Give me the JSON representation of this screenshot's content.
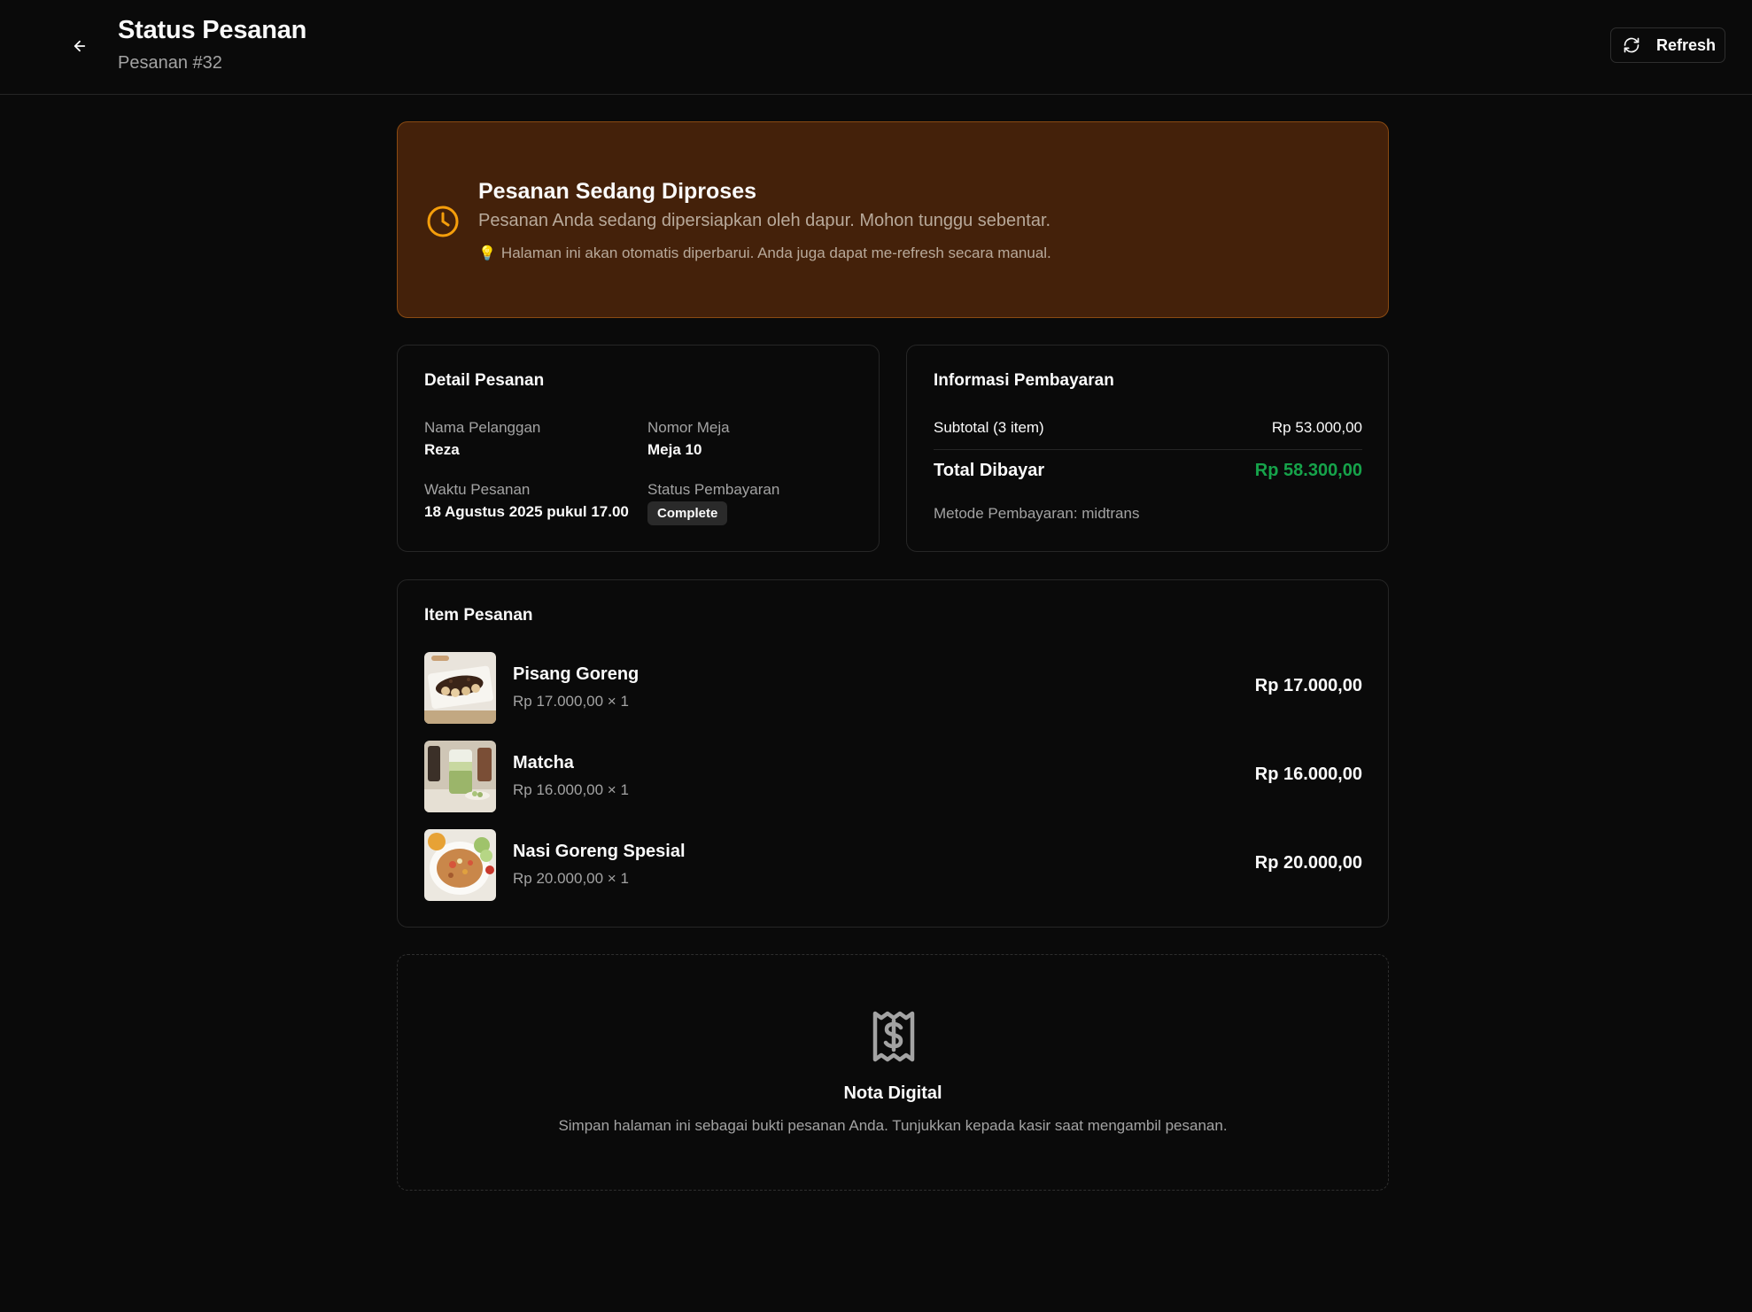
{
  "header": {
    "title": "Status Pesanan",
    "subtitle": "Pesanan #32",
    "refresh_label": "Refresh",
    "back_icon": "arrow-left-icon",
    "refresh_icon": "refresh-icon"
  },
  "banner": {
    "title": "Pesanan Sedang Diproses",
    "description": "Pesanan Anda sedang dipersiapkan oleh dapur. Mohon tunggu sebentar.",
    "hint_icon": "💡",
    "hint": "Halaman ini akan otomatis diperbarui. Anda juga dapat me-refresh secara manual.",
    "icon": "clock-icon",
    "accent_color": "#f59e0b"
  },
  "detail": {
    "title": "Detail Pesanan",
    "customer_label": "Nama Pelanggan",
    "customer_value": "Reza",
    "table_label": "Nomor Meja",
    "table_value": "Meja 10",
    "time_label": "Waktu Pesanan",
    "time_value": "18 Agustus 2025 pukul 17.00",
    "payment_status_label": "Status Pembayaran",
    "payment_status_value": "Complete"
  },
  "payment": {
    "title": "Informasi Pembayaran",
    "subtotal_label": "Subtotal (3 item)",
    "subtotal_value": "Rp 53.000,00",
    "total_label": "Total Dibayar",
    "total_value": "Rp 58.300,00",
    "method": "Metode Pembayaran: midtrans",
    "total_color": "#16a34a"
  },
  "items": {
    "title": "Item Pesanan",
    "list": [
      {
        "name": "Pisang Goreng",
        "unit": "Rp 17.000,00 × 1",
        "total": "Rp 17.000,00"
      },
      {
        "name": "Matcha",
        "unit": "Rp 16.000,00 × 1",
        "total": "Rp 16.000,00"
      },
      {
        "name": "Nasi Goreng Spesial",
        "unit": "Rp 20.000,00 × 1",
        "total": "Rp 20.000,00"
      }
    ]
  },
  "receipt": {
    "icon": "receipt-dollar-icon",
    "title": "Nota Digital",
    "description": "Simpan halaman ini sebagai bukti pesanan Anda. Tunjukkan kepada kasir saat mengambil pesanan."
  }
}
